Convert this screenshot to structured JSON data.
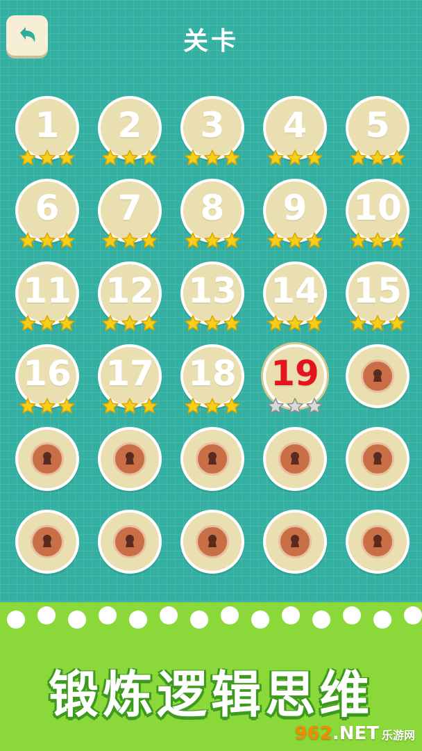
{
  "header": {
    "title": "关卡",
    "back_icon": "back-arrow-icon"
  },
  "levels": [
    {
      "num": "1",
      "stars": 3,
      "state": "done"
    },
    {
      "num": "2",
      "stars": 3,
      "state": "done"
    },
    {
      "num": "3",
      "stars": 3,
      "state": "done"
    },
    {
      "num": "4",
      "stars": 3,
      "state": "done"
    },
    {
      "num": "5",
      "stars": 3,
      "state": "done"
    },
    {
      "num": "6",
      "stars": 3,
      "state": "done"
    },
    {
      "num": "7",
      "stars": 3,
      "state": "done"
    },
    {
      "num": "8",
      "stars": 3,
      "state": "done"
    },
    {
      "num": "9",
      "stars": 3,
      "state": "done"
    },
    {
      "num": "10",
      "stars": 3,
      "state": "done"
    },
    {
      "num": "11",
      "stars": 3,
      "state": "done"
    },
    {
      "num": "12",
      "stars": 3,
      "state": "done"
    },
    {
      "num": "13",
      "stars": 3,
      "state": "done"
    },
    {
      "num": "14",
      "stars": 3,
      "state": "done"
    },
    {
      "num": "15",
      "stars": 3,
      "state": "done"
    },
    {
      "num": "16",
      "stars": 3,
      "state": "done"
    },
    {
      "num": "17",
      "stars": 3,
      "state": "done"
    },
    {
      "num": "18",
      "stars": 3,
      "state": "done"
    },
    {
      "num": "19",
      "stars": 0,
      "state": "current"
    },
    {
      "num": "",
      "stars": 0,
      "state": "locked"
    },
    {
      "num": "",
      "stars": 0,
      "state": "locked"
    },
    {
      "num": "",
      "stars": 0,
      "state": "locked"
    },
    {
      "num": "",
      "stars": 0,
      "state": "locked"
    },
    {
      "num": "",
      "stars": 0,
      "state": "locked"
    },
    {
      "num": "",
      "stars": 0,
      "state": "locked"
    },
    {
      "num": "",
      "stars": 0,
      "state": "locked"
    },
    {
      "num": "",
      "stars": 0,
      "state": "locked"
    },
    {
      "num": "",
      "stars": 0,
      "state": "locked"
    },
    {
      "num": "",
      "stars": 0,
      "state": "locked"
    },
    {
      "num": "",
      "stars": 0,
      "state": "locked"
    }
  ],
  "footer": {
    "slogan": "锻炼逻辑思维"
  },
  "watermark": {
    "brand_a": "962",
    "brand_b": ".NET",
    "sub": "乐游网"
  },
  "colors": {
    "background": "#33b0a2",
    "tile": "#eadfb0",
    "star_on": "#f7cf1a",
    "star_off": "#d9d9d9",
    "current_number": "#e3141b",
    "lock": "#c96f47",
    "footer": "#8bd83a"
  }
}
